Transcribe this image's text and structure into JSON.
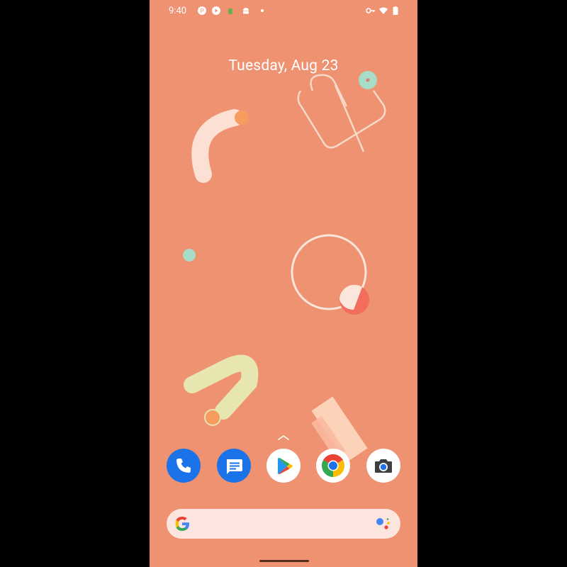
{
  "status_bar": {
    "time": "9:40",
    "icons": [
      "notification-icon-p",
      "notification-icon-p-play",
      "notification-icon-android-green",
      "notification-icon-android",
      "more-notifications-dot",
      "vpn-key-icon",
      "wifi-icon",
      "battery-icon"
    ]
  },
  "home": {
    "date": "Tuesday, Aug 23"
  },
  "dock": {
    "apps": [
      {
        "name": "Phone",
        "icon": "phone-icon",
        "color": "#1a73e8"
      },
      {
        "name": "Messages",
        "icon": "messages-icon",
        "color": "#1a73e8"
      },
      {
        "name": "Play Store",
        "icon": "play-store-icon",
        "color": "#ffffff"
      },
      {
        "name": "Chrome",
        "icon": "chrome-icon",
        "color": "#ffffff"
      },
      {
        "name": "Camera",
        "icon": "camera-icon",
        "color": "#ffffff"
      }
    ]
  },
  "search": {
    "placeholder": "",
    "icons": [
      "google-g-icon",
      "google-assistant-icon"
    ]
  },
  "colors": {
    "wallpaper": "#ee9272",
    "accent_blue": "#1a73e8",
    "search_bg": "#fbe5de"
  }
}
